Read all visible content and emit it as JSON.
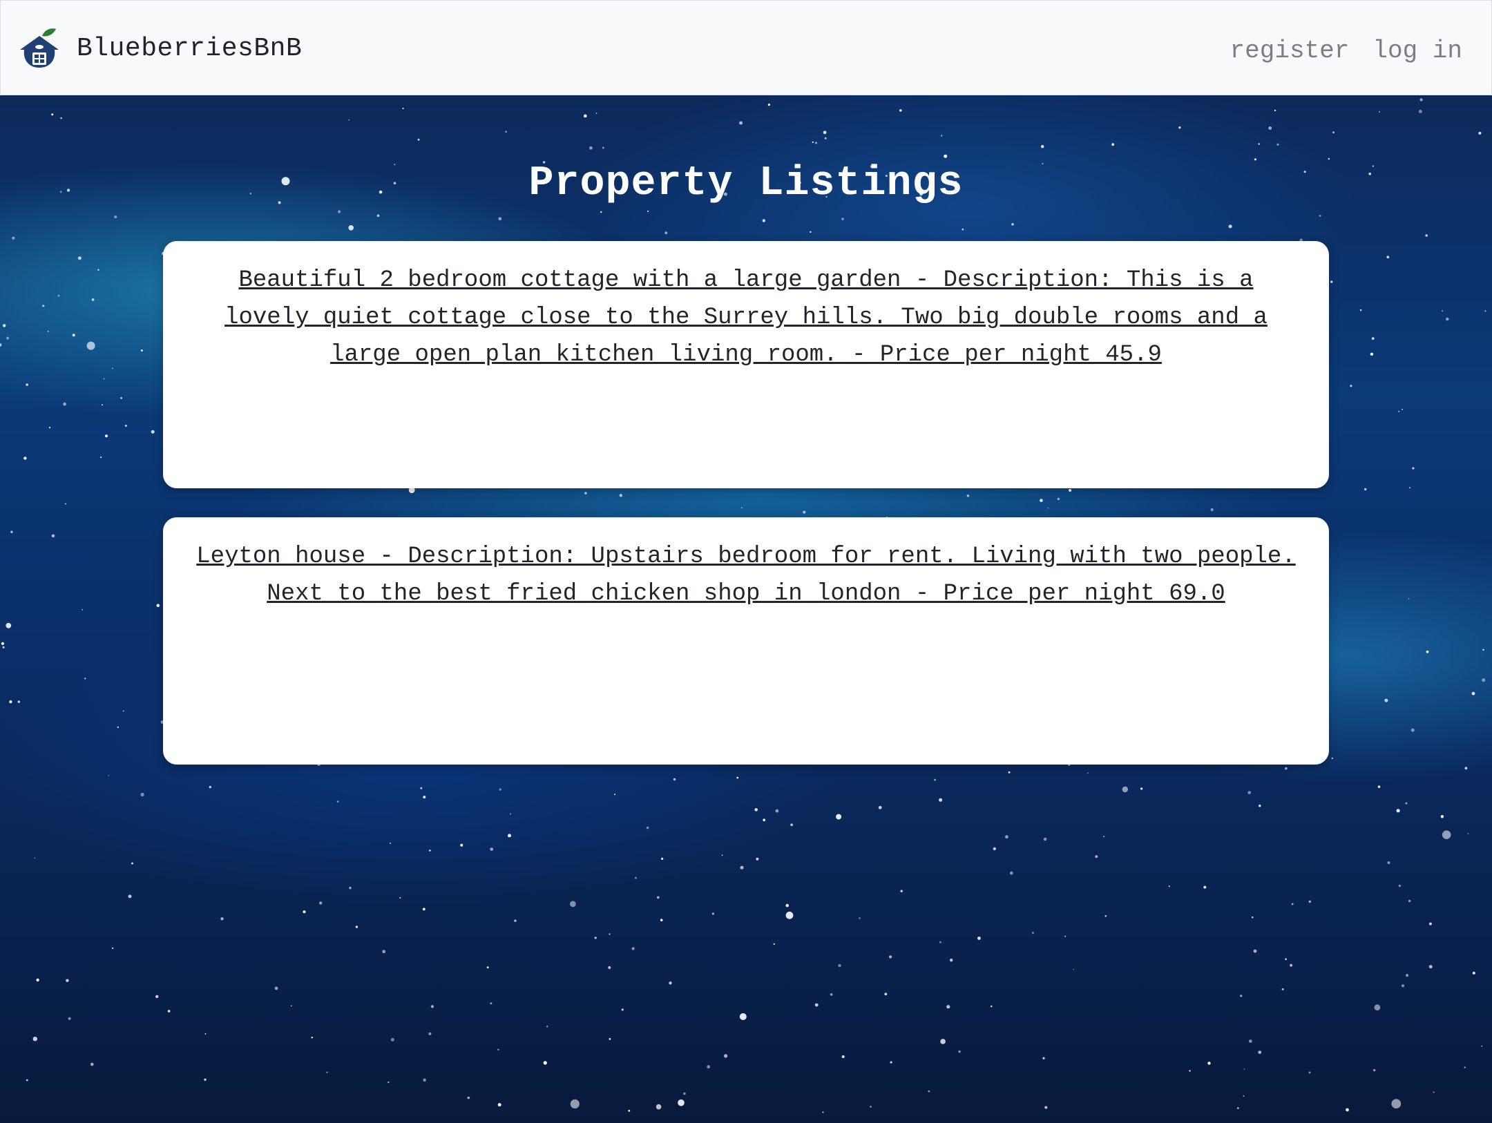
{
  "navbar": {
    "brand": "BlueberriesBnB",
    "links": [
      {
        "label": "register"
      },
      {
        "label": "log in"
      }
    ]
  },
  "main": {
    "title": "Property Listings",
    "listings": [
      {
        "text": "Beautiful 2 bedroom cottage with a large garden - Description: This is a lovely quiet cottage close to the Surrey hills. Two big double rooms and a large open plan kitchen living room. - Price per night 45.9"
      },
      {
        "text": "Leyton house - Description: Upstairs bedroom for rent. Living with two people. Next to the best fried chicken shop in london - Price per night 69.0"
      }
    ]
  },
  "colors": {
    "navbar_bg": "#f8f9fa",
    "brand_blue": "#1f3f75",
    "leaf_green": "#2e7d32",
    "card_bg": "#ffffff"
  }
}
